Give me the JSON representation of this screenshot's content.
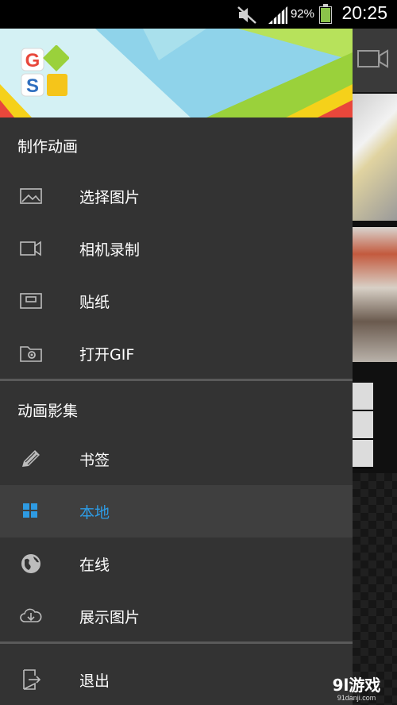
{
  "status_bar": {
    "battery_percent": "92%",
    "battery_level": 0.92,
    "time": "20:25",
    "icons": [
      "mute-icon",
      "signal-icon",
      "battery-icon"
    ]
  },
  "drawer": {
    "sections": [
      {
        "title": "制作动画",
        "items": [
          {
            "label": "选择图片",
            "icon": "image-icon"
          },
          {
            "label": "相机录制",
            "icon": "video-camera-icon"
          },
          {
            "label": "贴纸",
            "icon": "sticker-icon"
          },
          {
            "label": "打开GIF",
            "icon": "folder-gear-icon"
          }
        ]
      },
      {
        "title": "动画影集",
        "items": [
          {
            "label": "书签",
            "icon": "pencil-icon"
          },
          {
            "label": "本地",
            "icon": "grid-icon",
            "selected": true
          },
          {
            "label": "在线",
            "icon": "globe-icon"
          },
          {
            "label": "展示图片",
            "icon": "cloud-download-icon"
          }
        ]
      }
    ],
    "exit_label": "退出",
    "exit_icon": "exit-icon",
    "accent_color": "#2e9be3"
  },
  "watermark": {
    "main": "9l游戏",
    "sub": "91danji.com"
  }
}
